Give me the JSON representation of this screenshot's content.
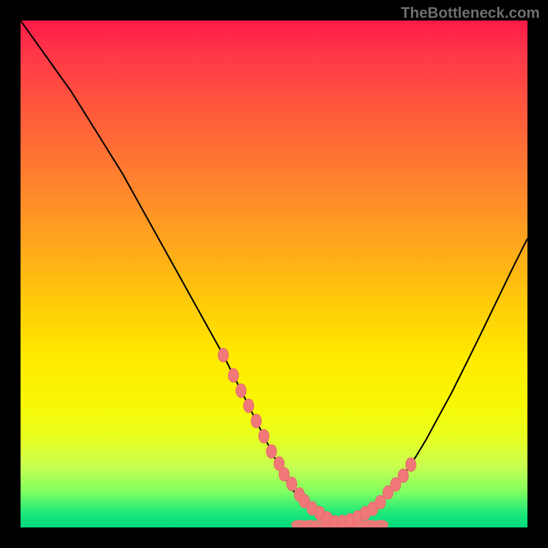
{
  "watermark": "TheBottleneck.com",
  "colors": {
    "frame": "#000000",
    "curve": "#000000",
    "marker_fill": "#f07878",
    "marker_stroke": "#e86a6a",
    "gradient_top": "#ff1a4a",
    "gradient_bottom": "#00d97e"
  },
  "chart_data": {
    "type": "line",
    "title": "",
    "xlabel": "",
    "ylabel": "",
    "xlim": [
      0,
      100
    ],
    "ylim": [
      0,
      100
    ],
    "grid": false,
    "series": [
      {
        "name": "left-curve",
        "x": [
          0,
          5,
          10,
          15,
          20,
          25,
          30,
          35,
          40,
          45,
          48,
          50,
          52,
          54,
          56,
          58,
          60,
          62
        ],
        "y": [
          100,
          93,
          86,
          78,
          70,
          61,
          52,
          43,
          34,
          24,
          18,
          14,
          10,
          7,
          4.5,
          2.8,
          1.6,
          1.0
        ]
      },
      {
        "name": "right-curve",
        "x": [
          62,
          64,
          66,
          68,
          70,
          72,
          74,
          76,
          78,
          80,
          82,
          85,
          88,
          91,
          94,
          97,
          100
        ],
        "y": [
          1.0,
          1.2,
          1.8,
          2.8,
          4.3,
          6.2,
          8.5,
          11.0,
          14.0,
          17.3,
          21.0,
          26.5,
          32.5,
          38.6,
          44.8,
          51.0,
          57.0
        ]
      }
    ],
    "markers_left": {
      "name": "highlight-left",
      "x": [
        40,
        42,
        43.5,
        45,
        46.5,
        48,
        49.5,
        51,
        52,
        53.5,
        55,
        56,
        57.5,
        59,
        60.5,
        62
      ],
      "y": [
        34,
        30,
        27,
        24,
        21,
        18,
        15,
        12.6,
        10.5,
        8.6,
        6.5,
        5.2,
        3.8,
        2.8,
        1.8,
        1.0
      ]
    },
    "markers_right": {
      "name": "highlight-right",
      "x": [
        62,
        63.5,
        65,
        66.5,
        68,
        69.5,
        71,
        72.5,
        74,
        75.5,
        77
      ],
      "y": [
        1.0,
        1.1,
        1.4,
        2.0,
        2.8,
        3.7,
        5.0,
        6.9,
        8.5,
        10.2,
        12.4
      ]
    },
    "bottom_lobes": {
      "x": [
        55,
        57,
        59,
        61,
        63,
        65,
        67,
        69,
        71
      ],
      "rx": [
        5,
        5,
        5,
        5,
        5,
        5,
        5,
        5,
        5
      ]
    }
  }
}
